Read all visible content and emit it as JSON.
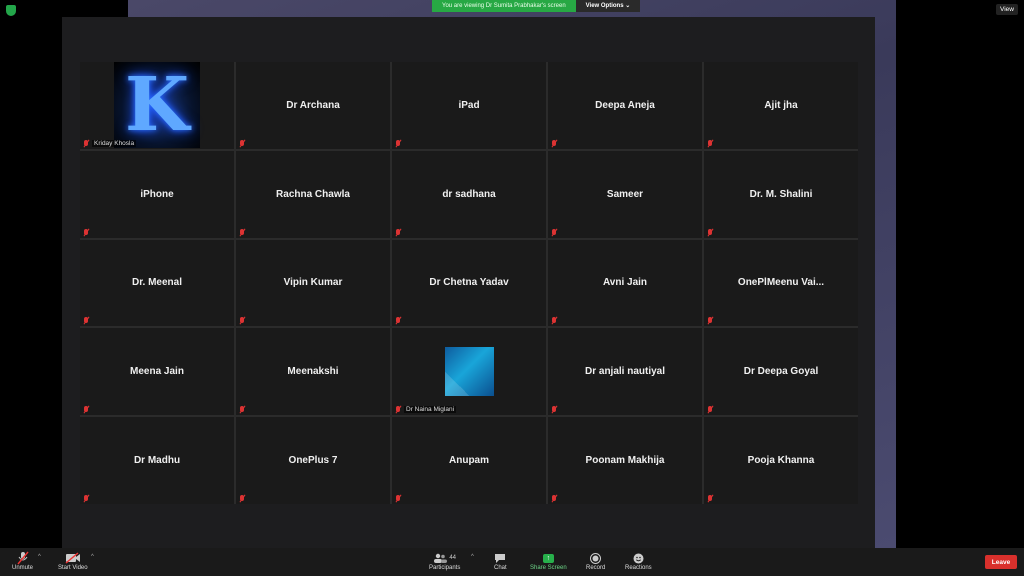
{
  "banner": {
    "viewing": "You are viewing Dr Sumita Prabhakar's screen",
    "options": "View Options ⌄"
  },
  "view_button": "View",
  "participants": [
    {
      "name": "Kriday Khosla",
      "avatar": "K"
    },
    {
      "name": "Dr Archana"
    },
    {
      "name": "iPad"
    },
    {
      "name": "Deepa Aneja"
    },
    {
      "name": "Ajit jha"
    },
    {
      "name": "iPhone"
    },
    {
      "name": "Rachna Chawla"
    },
    {
      "name": "dr sadhana"
    },
    {
      "name": "Sameer"
    },
    {
      "name": "Dr. M. Shalini"
    },
    {
      "name": "Dr. Meenal"
    },
    {
      "name": "Vipin Kumar"
    },
    {
      "name": "Dr Chetna Yadav"
    },
    {
      "name": "Avni Jain"
    },
    {
      "name": "OnePlMeenu  Vai..."
    },
    {
      "name": "Meena Jain"
    },
    {
      "name": "Meenakshi"
    },
    {
      "name": "Dr Naina Miglani",
      "avatar": "poly"
    },
    {
      "name": "Dr anjali nautiyal"
    },
    {
      "name": "Dr Deepa Goyal"
    },
    {
      "name": "Dr Madhu"
    },
    {
      "name": "OnePlus 7"
    },
    {
      "name": "Anupam"
    },
    {
      "name": "Poonam Makhija"
    },
    {
      "name": "Pooja Khanna"
    }
  ],
  "toolbar": {
    "unmute": "Unmute",
    "start_video": "Start Video",
    "participants": "Participants",
    "participants_count": "44",
    "chat": "Chat",
    "share_screen": "Share Screen",
    "record": "Record",
    "reactions": "Reactions",
    "leave": "Leave"
  },
  "colors": {
    "leave": "#d9302c",
    "share": "#27b04b",
    "banner": "#27a844",
    "muted": "#dd3333"
  }
}
